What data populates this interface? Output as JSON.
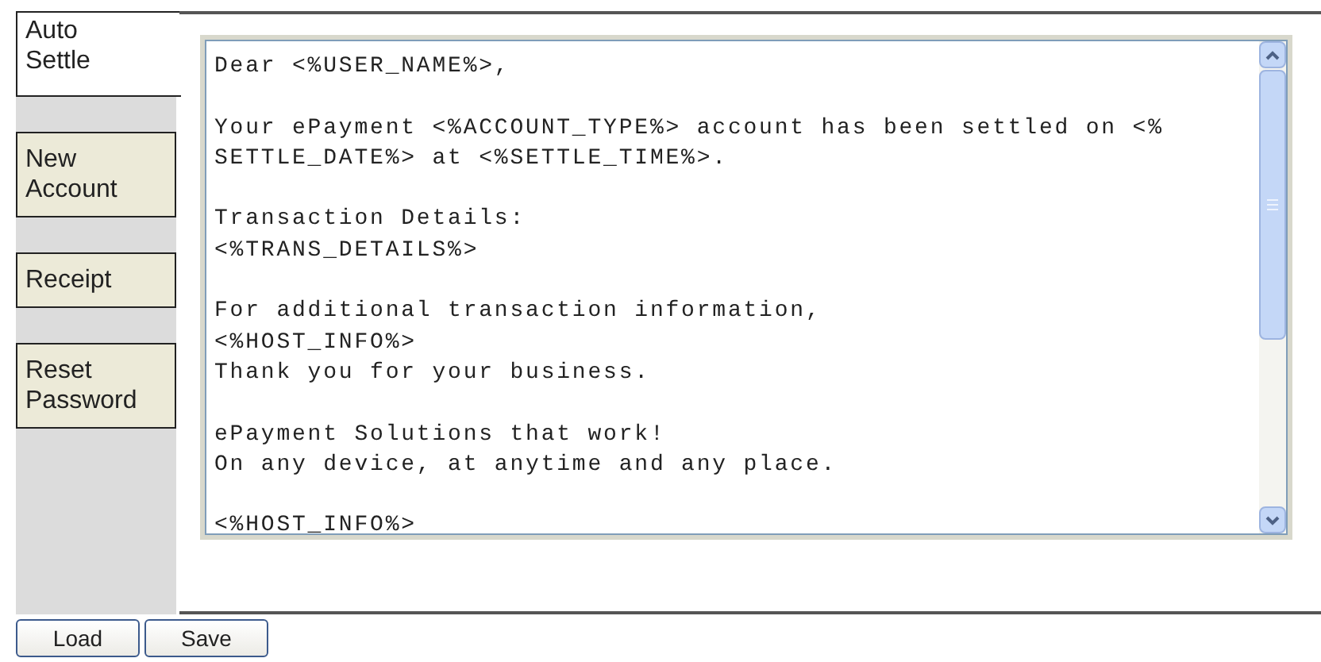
{
  "tabs": [
    {
      "label": "Auto Settle",
      "selected": true
    },
    {
      "label": "New Account",
      "selected": false
    },
    {
      "label": "Receipt",
      "selected": false
    },
    {
      "label": "Reset Password",
      "selected": false
    }
  ],
  "editor": {
    "paragraphs": [
      [
        "Dear <%USER_NAME%>,"
      ],
      [
        "Your ePayment <%ACCOUNT_TYPE%> account has been settled on <%",
        "SETTLE_DATE%> at <%SETTLE_TIME%>."
      ],
      [
        "Transaction Details:",
        "<%TRANS_DETAILS%>"
      ],
      [
        "For additional transaction information,",
        "<%HOST_INFO%>",
        "Thank you for your business."
      ],
      [
        "ePayment Solutions that work!",
        "On any device, at anytime and any place."
      ],
      [
        "<%HOST_INFO%>"
      ]
    ]
  },
  "buttons": [
    "Load",
    "Save"
  ]
}
